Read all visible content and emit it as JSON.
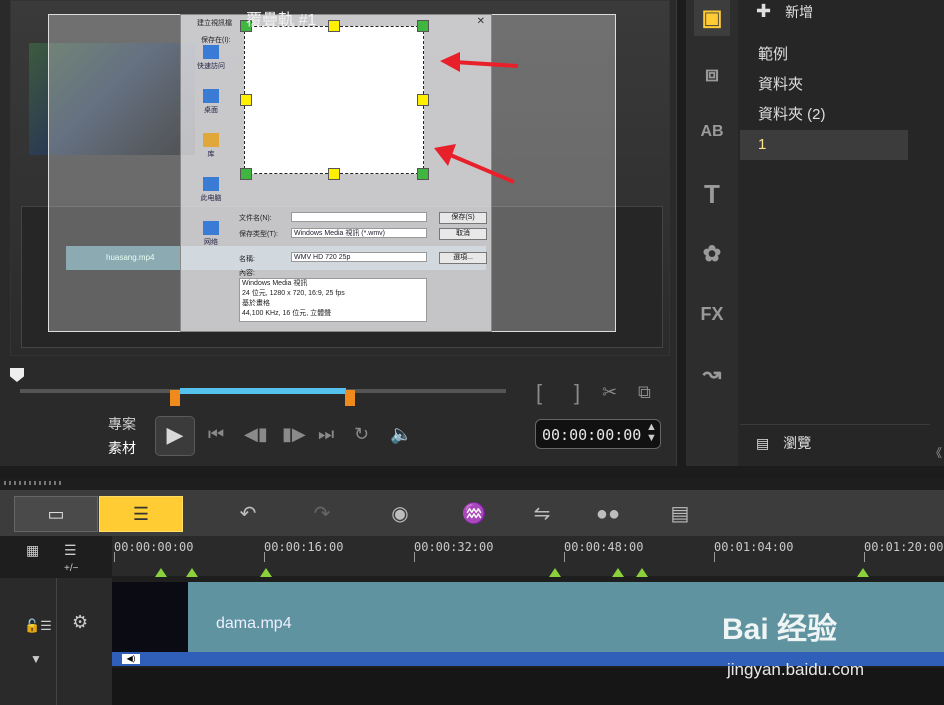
{
  "overlay": {
    "title": "覆疊軌 #1",
    "dialog": {
      "title": "建立視訊檔",
      "save_in_label": "保存在(I):",
      "sidebar": [
        "快速訪问",
        "桌面",
        "库",
        "此电脑",
        "网络"
      ],
      "filename_label": "文件名(N):",
      "filetype_label": "保存类型(T):",
      "filetype_value": "Windows Media 視訊 (*.wmv)",
      "save_button": "保存(S)",
      "cancel_button": "取消",
      "name_label": "名稱:",
      "name_value": "WMV HD 720 25p",
      "options_button": "選項...",
      "content_label": "內容:",
      "content_lines": [
        "Windows Media 視訊",
        "24 位元, 1280 x 720, 16:9, 25 fps",
        "基於畫格",
        "44,100 KHz, 16 位元, 立體聲"
      ]
    },
    "nested_clip_label": "huasang.mp4"
  },
  "player": {
    "mode_project": "專案",
    "mode_clip": "素材",
    "timecode": "00:00:00:00"
  },
  "library": {
    "add_label": "新增",
    "folders": [
      "範例",
      "資料夾",
      "資料夾 (2)",
      "1"
    ],
    "selected_index": 3,
    "browse_label": "瀏覽"
  },
  "timeline": {
    "ruler_ticks": [
      "00:00:00:00",
      "00:00:16:00",
      "00:00:32:00",
      "00:00:48:00",
      "00:01:04:00",
      "00:01:20:00"
    ],
    "zoom_label": "+/−",
    "clip_name": "dama.mp4"
  },
  "watermark": {
    "brand": "Bai 经验",
    "url": "jingyan.baidu.com"
  },
  "colors": {
    "accent_yellow": "#ffcc33",
    "scrub_blue": "#55c2ee",
    "clip_teal": "#5f93a0",
    "audio_blue": "#2f5fb8",
    "arrow_red": "#e8202a"
  }
}
